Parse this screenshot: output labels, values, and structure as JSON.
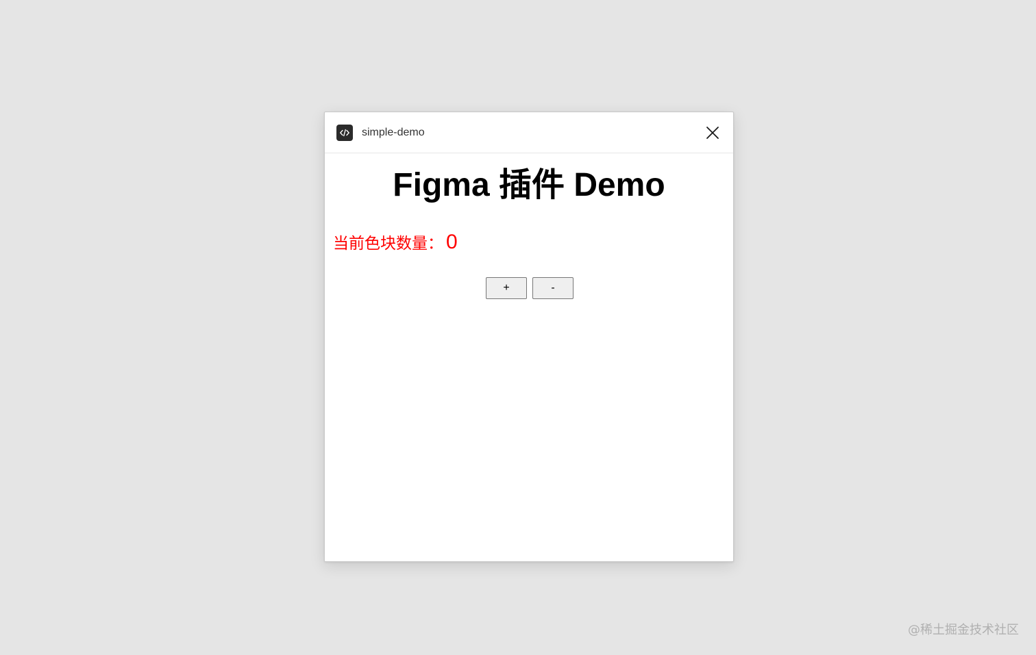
{
  "window": {
    "plugin_name": "simple-demo",
    "plugin_icon": "code-icon",
    "close_icon": "close-icon"
  },
  "content": {
    "heading": "Figma 插件 Demo",
    "counter_label": "当前色块数量：",
    "counter_value": "0",
    "counter_color": "#ff0000",
    "buttons": {
      "increment_label": "+",
      "decrement_label": "-"
    }
  },
  "watermark": "@稀土掘金技术社区"
}
